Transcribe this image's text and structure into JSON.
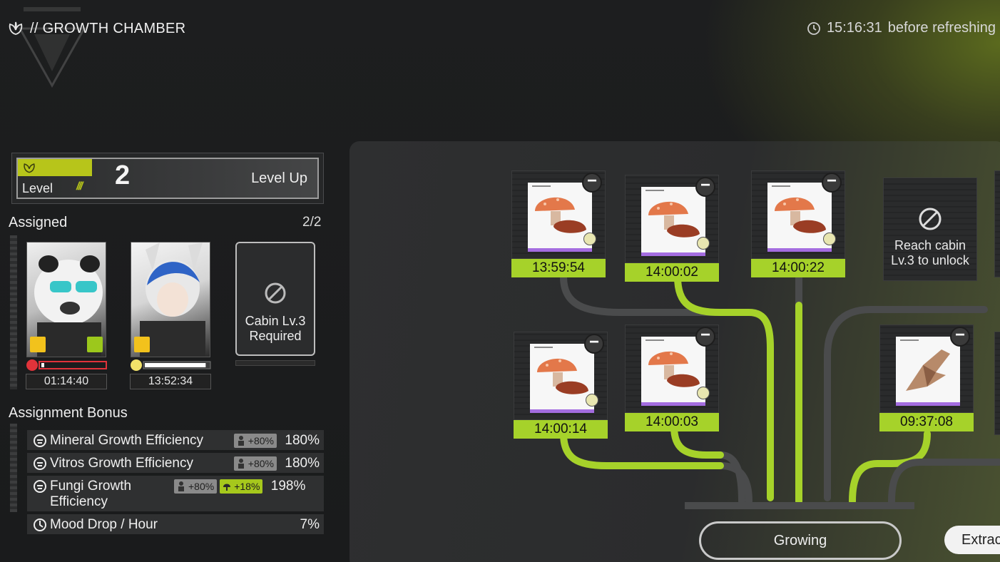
{
  "header": {
    "title": "// GROWTH CHAMBER",
    "refresh_time": "15:16:31",
    "refresh_suffix": "before refreshing"
  },
  "level": {
    "label": "Level",
    "value": "2",
    "level_up": "Level Up"
  },
  "assigned": {
    "title": "Assigned",
    "count": "2/2",
    "operators": [
      {
        "timer": "01:14:40",
        "mood_color": "#e0333a",
        "mood_fraction": 0.03
      },
      {
        "timer": "13:52:34",
        "mood_color": "#ffffff",
        "mood_fraction": 0.97
      }
    ],
    "locked_slot": "Cabin Lv.3 Required"
  },
  "bonus": {
    "title": "Assignment Bonus",
    "rows": [
      {
        "name": "Mineral Growth Efficiency",
        "ops_bonus": "+80%",
        "pct": "180%"
      },
      {
        "name": "Vitros Growth Efficiency",
        "ops_bonus": "+80%",
        "pct": "180%"
      },
      {
        "name": "Fungi Growth Efficiency",
        "ops_bonus": "+80%",
        "extra_bonus": "+18%",
        "pct": "198%"
      },
      {
        "name": "Mood Drop / Hour",
        "pct": "7%"
      }
    ]
  },
  "chamber": {
    "slots": [
      {
        "timer": "13:59:54",
        "item": "mushroom-icon"
      },
      {
        "timer": "14:00:02",
        "item": "mushroom-icon"
      },
      {
        "timer": "14:00:22",
        "item": "mushroom-icon"
      },
      {
        "timer": "14:00:14",
        "item": "mushroom-icon"
      },
      {
        "timer": "14:00:03",
        "item": "mushroom-icon"
      },
      {
        "timer": "09:37:08",
        "item": "crystal-shard-icon"
      }
    ],
    "locked_slot": "Reach cabin Lv.3 to unlock",
    "status": "Growing",
    "extract_label": "Extrac"
  },
  "colors": {
    "accent_green": "#a6d22a",
    "level_tab": "#b7c51a",
    "purple": "#a943d6"
  }
}
